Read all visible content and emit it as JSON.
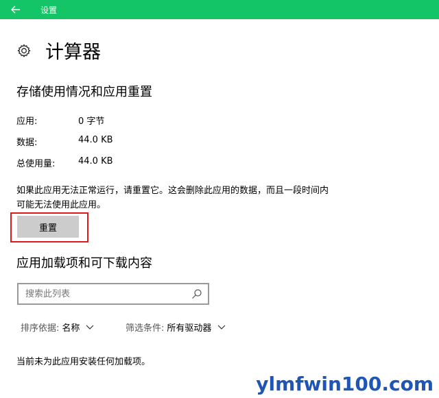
{
  "titlebar": {
    "title": "设置",
    "accent": "#13c566"
  },
  "app": {
    "name": "计算器"
  },
  "storage": {
    "heading": "存储使用情况和应用重置",
    "rows": [
      {
        "label": "应用:",
        "value": "0 字节"
      },
      {
        "label": "数据:",
        "value": "44.0 KB"
      },
      {
        "label": "总使用量:",
        "value": "44.0 KB"
      }
    ],
    "description": "如果此应用无法正常运行，请重置它。这会删除此应用的数据，而且一段时间内可能无法使用此应用。",
    "reset_label": "重置",
    "highlight_color": "#e0181e"
  },
  "addons": {
    "heading": "应用加载项和可下载内容",
    "search_placeholder": "搜索此列表",
    "sort_label": "排序依据:",
    "sort_value": "名称",
    "filter_label": "筛选条件:",
    "filter_value": "所有驱动器",
    "empty_message": "当前未为此应用安装任何加载项。"
  },
  "watermark": "ylmfwin100.com"
}
